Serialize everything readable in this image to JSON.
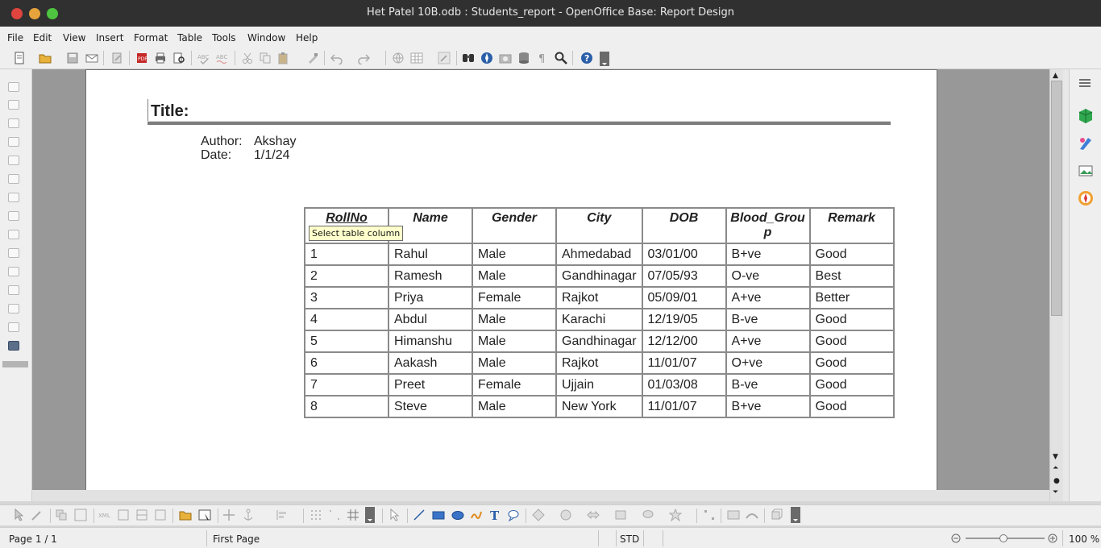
{
  "window": {
    "title": "Het Patel 10B.odb : Students_report - OpenOffice Base: Report Design"
  },
  "menu": {
    "items": [
      "File",
      "Edit",
      "View",
      "Insert",
      "Format",
      "Table",
      "Tools",
      "Window",
      "Help"
    ]
  },
  "report": {
    "title_label": "Title:",
    "author_label": "Author:",
    "author_value": "Akshay",
    "date_label": "Date:",
    "date_value": "1/1/24"
  },
  "table": {
    "columns": [
      "RollNo",
      "Name",
      "Gender",
      "City",
      "DOB",
      "Blood_Grou\np",
      "Remark"
    ],
    "rows": [
      [
        "1",
        "Rahul",
        "Male",
        "Ahmedabad",
        "03/01/00",
        "B+ve",
        "Good"
      ],
      [
        "2",
        "Ramesh",
        "Male",
        "Gandhinagar",
        "07/05/93",
        "O-ve",
        "Best"
      ],
      [
        "3",
        "Priya",
        "Female",
        "Rajkot",
        "05/09/01",
        "A+ve",
        "Better"
      ],
      [
        "4",
        "Abdul",
        "Male",
        "Karachi",
        "12/19/05",
        "B-ve",
        "Good"
      ],
      [
        "5",
        "Himanshu",
        "Male",
        "Gandhinagar",
        "12/12/00",
        "A+ve",
        "Good"
      ],
      [
        "6",
        "Aakash",
        "Male",
        "Rajkot",
        "11/01/07",
        "O+ve",
        "Good"
      ],
      [
        "7",
        "Preet",
        "Female",
        "Ujjain",
        "01/03/08",
        "B-ve",
        "Good"
      ],
      [
        "8",
        "Steve",
        "Male",
        "New York",
        "11/01/07",
        "B+ve",
        "Good"
      ]
    ]
  },
  "tooltip": {
    "text": "Select table column"
  },
  "status": {
    "page": "Page 1 / 1",
    "page_style": "First Page",
    "mode": "STD",
    "zoom": "100 %"
  },
  "colors": {
    "titlebar": "#303030",
    "chrome": "#efefef",
    "canvas": "#989898",
    "tooltip": "#ffffcc"
  }
}
